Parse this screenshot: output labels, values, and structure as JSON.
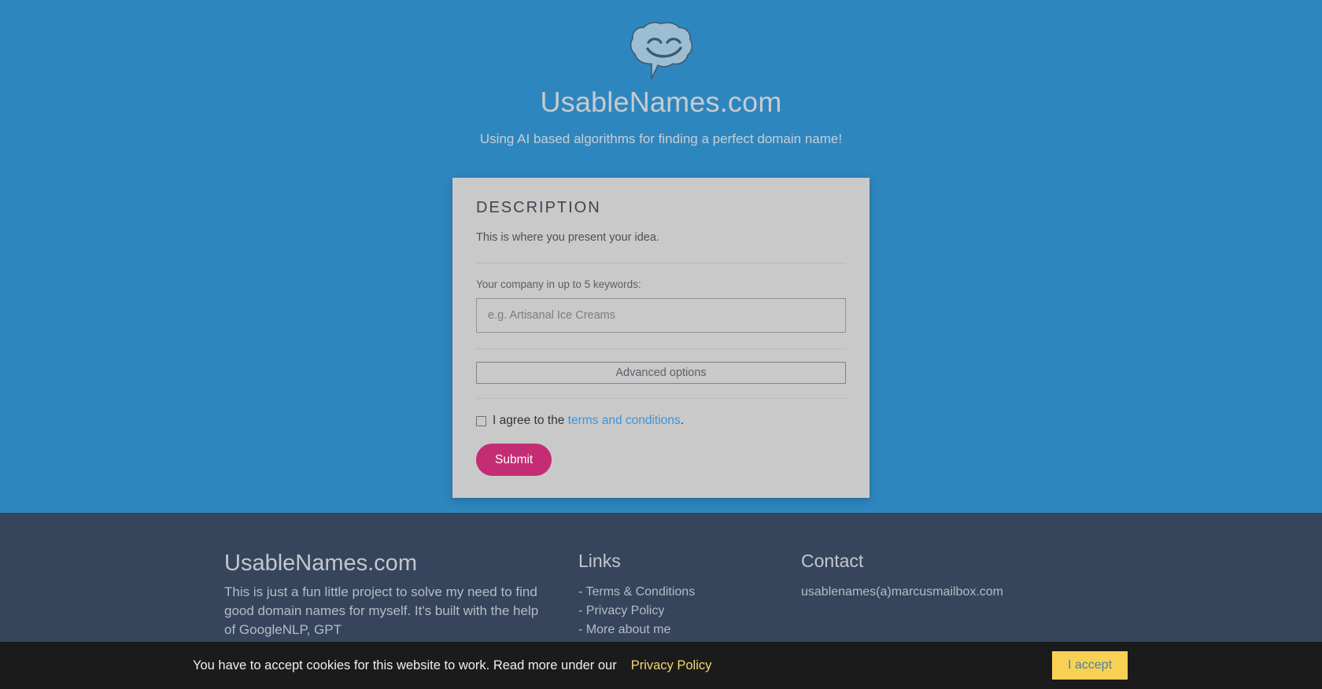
{
  "site": {
    "brand": "UsableNames.com",
    "tagline": "Using AI based algorithms for finding a perfect domain name!",
    "logo_icon": "brain-speech-bubble-smiling-icon",
    "colors": {
      "hero_background": "#2e86bf",
      "card_background": "#c9c9c9",
      "footer_background": "#36455c",
      "submit_accent": "#c42c73",
      "link_blue": "#3d93d8",
      "cookie_background": "#1b1b1b",
      "cookie_accent": "#f8d154"
    }
  },
  "card": {
    "title": "DESCRIPTION",
    "subtitle": "This is where you present your idea.",
    "keywords_label": "Your company in up to 5 keywords:",
    "keywords_placeholder": "e.g. Artisanal Ice Creams",
    "keywords_value": "",
    "advanced_options_label": "Advanced options",
    "agree_prefix": "I agree to the ",
    "agree_link": "terms and conditions",
    "agree_suffix": ".",
    "agree_checked": false,
    "submit_label": "Submit"
  },
  "footer": {
    "about": {
      "brand": "UsableNames.com",
      "text": "This is just a fun little project to solve my need to find good domain names for myself. It's built with the help of GoogleNLP, GPT"
    },
    "links": {
      "heading": "Links",
      "items": [
        "- Terms & Conditions",
        "- Privacy Policy",
        "- More about me"
      ]
    },
    "contact": {
      "heading": "Contact",
      "email": "usablenames(a)marcusmailbox.com"
    }
  },
  "cookie_banner": {
    "message": "You have to accept cookies for this website to work. Read more under our",
    "policy_link": "Privacy Policy",
    "accept_label": "I accept"
  }
}
